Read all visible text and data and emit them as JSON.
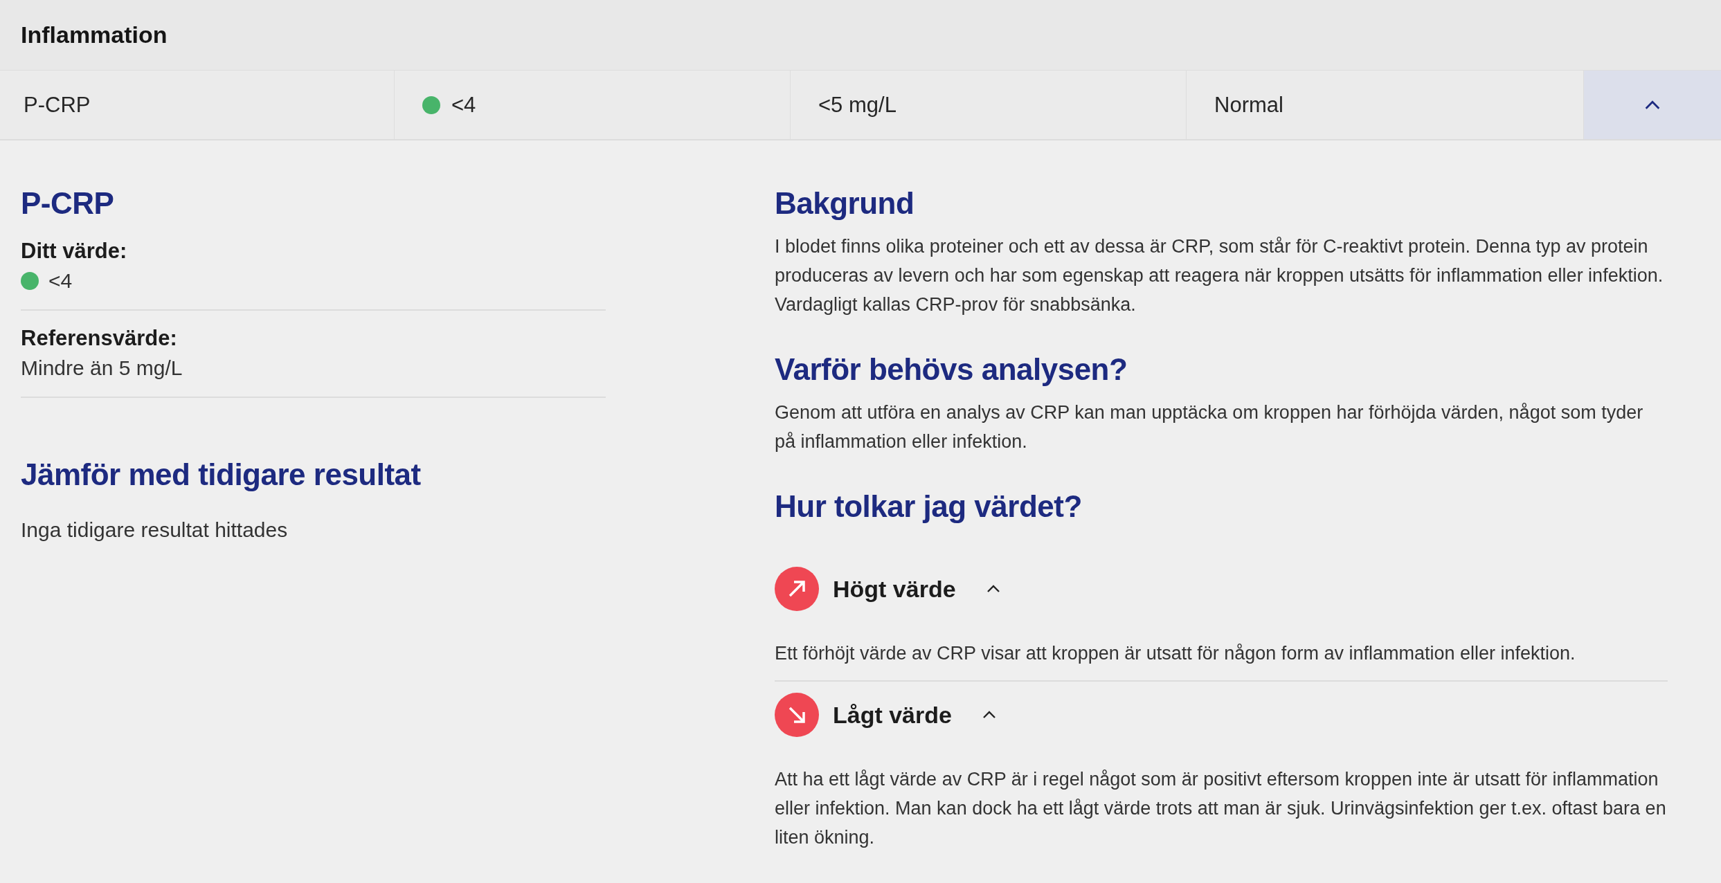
{
  "section": {
    "title": "Inflammation"
  },
  "result_row": {
    "name": "P-CRP",
    "value": "<4",
    "color": "#48b46a",
    "reference": "<5 mg/L",
    "assessment": "Normal",
    "expanded": true
  },
  "detail": {
    "title": "P-CRP",
    "your_value": {
      "label": "Ditt värde:",
      "value": "<4",
      "color": "#48b46a"
    },
    "reference": {
      "label": "Referensvärde:",
      "value": "Mindre än 5 mg/L"
    },
    "compare": {
      "title": "Jämför med tidigare resultat",
      "text": "Inga tidigare resultat hittades"
    }
  },
  "info": {
    "sections": [
      {
        "title": "Bakgrund",
        "text": "I blodet finns olika proteiner och ett av dessa är CRP, som står för C-reaktivt protein. Denna typ av protein produceras av levern och har som egenskap att reagera när kroppen utsätts för inflammation eller infektion. Vardagligt kallas CRP-prov för snabbsänka."
      },
      {
        "title": "Varför behövs analysen?",
        "text": "Genom att utföra en analys av CRP kan man upptäcka om kroppen har förhöjda värden, något som tyder på inflammation eller infektion."
      }
    ],
    "interpretation": {
      "title": "Hur tolkar jag värdet?",
      "items": [
        {
          "kind": "high",
          "title": "Högt värde",
          "expanded": true,
          "text": "Ett förhöjt värde av CRP visar att kroppen är utsatt för någon form av inflammation eller infektion."
        },
        {
          "kind": "low",
          "title": "Lågt värde",
          "expanded": true,
          "text": "Att ha ett lågt värde av CRP är i regel något som är positivt eftersom kroppen inte är utsatt för inflammation eller infektion. Man kan dock ha ett lågt värde trots att man är sjuk. Urinvägsinfektion ger t.ex. oftast bara en liten ökning."
        }
      ]
    }
  }
}
